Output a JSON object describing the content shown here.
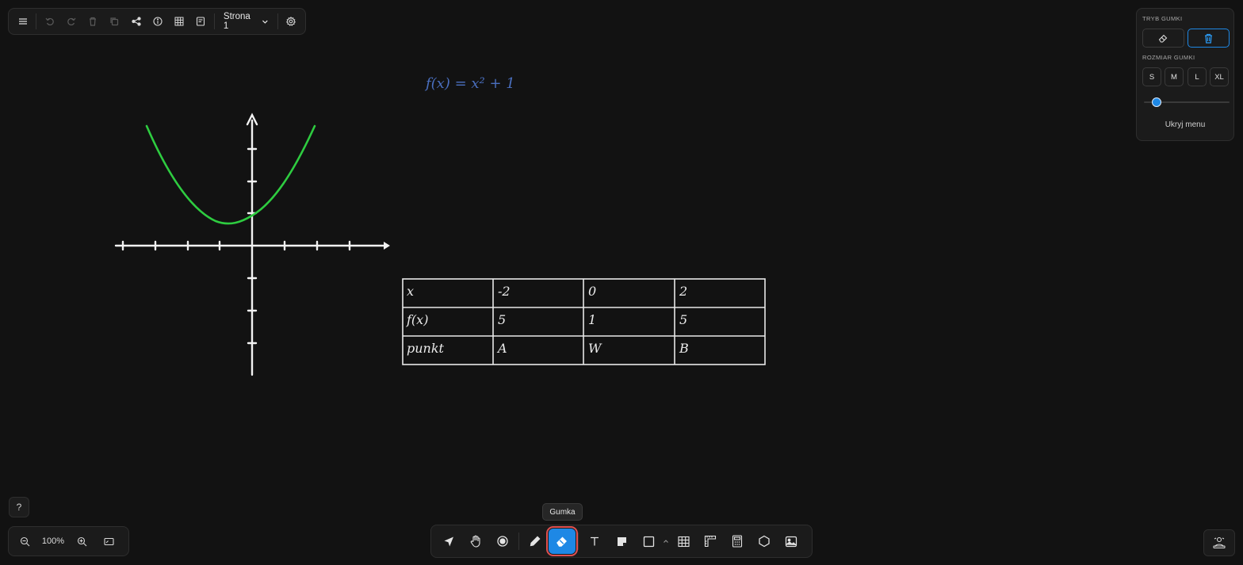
{
  "top_toolbar": {
    "page_label": "Strona 1",
    "icons": [
      "menu-icon",
      "undo-icon",
      "redo-icon",
      "trash-icon",
      "duplicate-icon",
      "share-icon",
      "info-icon",
      "grid-icon",
      "notes-icon",
      "chevron-down-icon",
      "gear-icon"
    ]
  },
  "eraser_panel": {
    "mode_title": "TRYB GUMKI",
    "size_title": "ROZMIAR GUMKI",
    "sizes": [
      "S",
      "M",
      "L",
      "XL"
    ],
    "slider_value": 0.1,
    "hide_menu": "Ukryj menu",
    "active_mode": "delete-object",
    "accent": "#1e88e5"
  },
  "canvas": {
    "formula": "f(x) = x² + 1",
    "formula_color": "#4a6fbf",
    "curve_color": "#2ecc40",
    "table": {
      "rows": [
        [
          "x",
          "-2",
          "0",
          "2"
        ],
        [
          "f(x)",
          "5",
          "1",
          "5"
        ],
        [
          "punkt",
          "A",
          "W",
          "B"
        ]
      ]
    }
  },
  "zoom": {
    "level": "100%"
  },
  "tooltip": "Gumka",
  "help": "?",
  "tools": [
    "pointer",
    "hand",
    "laser",
    "pen",
    "eraser",
    "text",
    "sticky-note",
    "shape",
    "table",
    "ruler",
    "calculator",
    "polygon",
    "image"
  ],
  "active_tool": "eraser"
}
